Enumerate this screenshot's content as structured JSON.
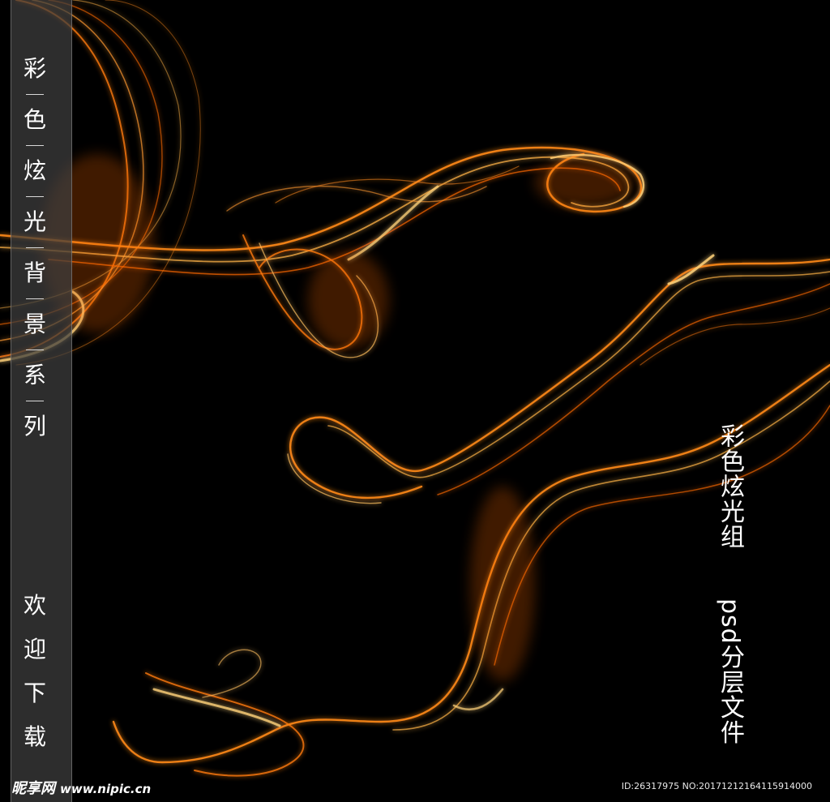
{
  "image": {
    "background_color": "#000000",
    "accent_color": "#ff8a1a",
    "description_colors": [
      "#ff6a00",
      "#ffb347",
      "#ffd27a"
    ]
  },
  "side_title": {
    "chars": [
      "彩",
      "色",
      "炫",
      "光",
      "背",
      "景",
      "系",
      "列"
    ]
  },
  "side_welcome": {
    "chars": [
      "欢",
      "迎",
      "下",
      "载"
    ]
  },
  "right_text": {
    "line1": "彩色炫光组",
    "line2": "psd分层文件"
  },
  "watermark": {
    "brand": "昵享网",
    "url": "www.nipic.cn",
    "id_text": "ID:26317975 NO:20171212164115914000"
  }
}
